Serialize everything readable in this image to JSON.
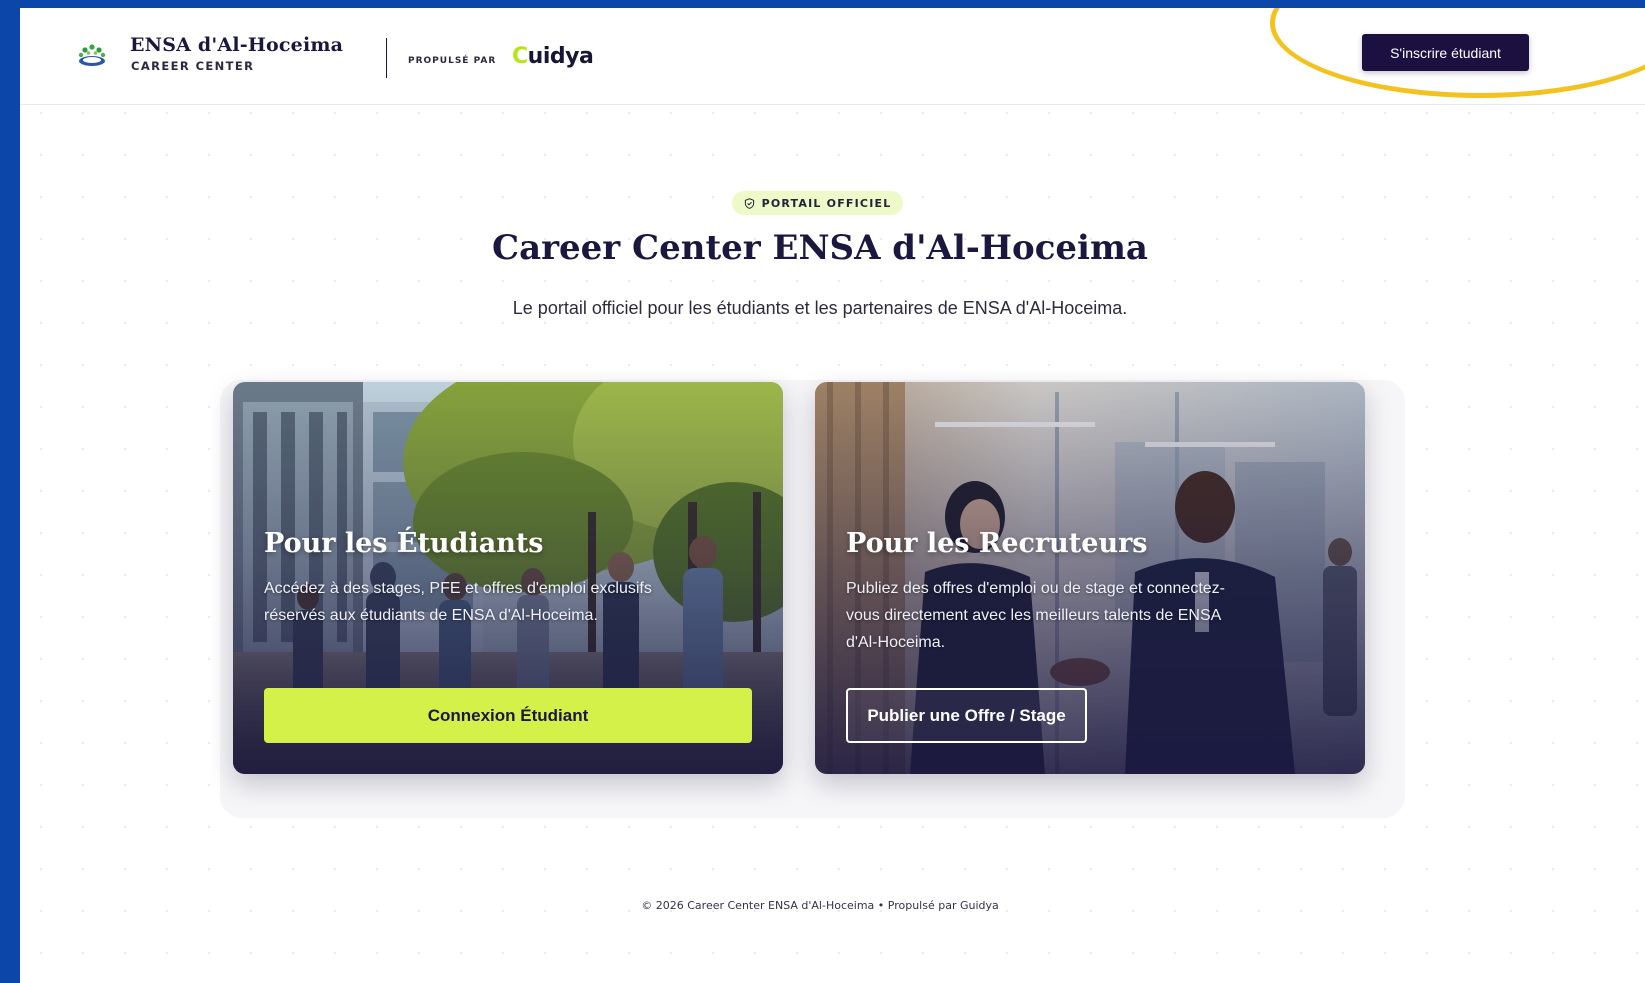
{
  "header": {
    "brand_title": "ENSA d'Al-Hoceima",
    "brand_subtitle": "CAREER CENTER",
    "powered_label": "PROPULSÉ PAR",
    "partner_logo_initial": "C",
    "partner_logo_rest": "uidya",
    "signup_button": "S'inscrire étudiant"
  },
  "hero": {
    "badge": "PORTAIL OFFICIEL",
    "title": "Career Center ENSA d'Al-Hoceima",
    "subtitle": "Le portail officiel pour les étudiants et les partenaires de ENSA d'Al-Hoceima."
  },
  "cards": {
    "students": {
      "title": "Pour les Étudiants",
      "description": "Accédez à des stages, PFE et offres d'emploi exclusifs réservés aux étudiants de ENSA d'Al-Hoceima.",
      "button": "Connexion Étudiant"
    },
    "recruiters": {
      "title": "Pour les Recruteurs",
      "description": "Publiez des offres d'emploi ou de stage et connectez-vous directement avec les meilleurs talents de ENSA d'Al-Hoceima.",
      "button": "Publier une Offre / Stage"
    }
  },
  "footer": {
    "text": "© 2026 Career Center ENSA d'Al-Hoceima • Propulsé par Guidya"
  },
  "colors": {
    "frame_blue": "#0b46a8",
    "navy": "#1b1040",
    "accent_lime": "#d4f14a",
    "highlight_yellow": "#f3c21f"
  }
}
